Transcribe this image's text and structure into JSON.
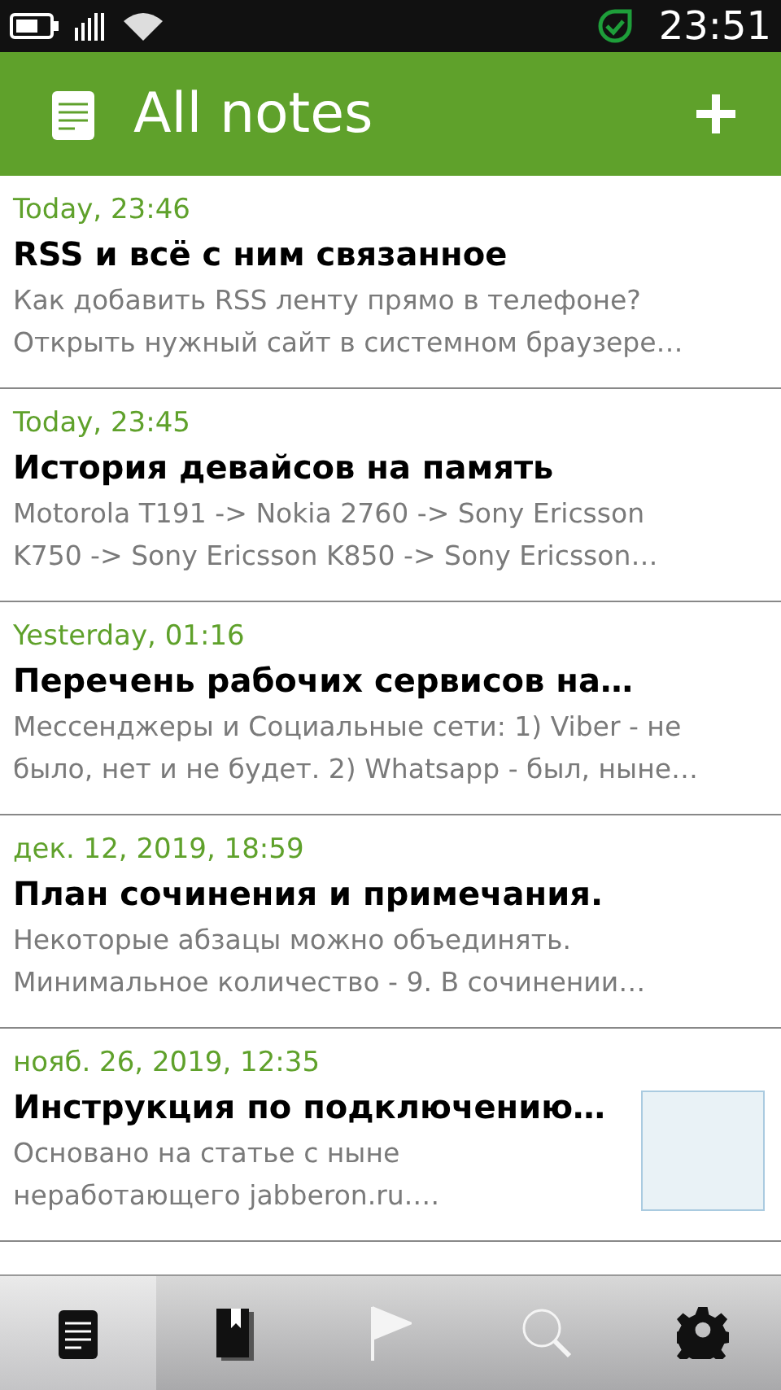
{
  "status_bar": {
    "time": "23:51"
  },
  "header": {
    "title": "All notes"
  },
  "notes": [
    {
      "date": "Today, 23:46",
      "title": "RSS и всё с ним связанное",
      "preview": "Как добавить RSS ленту прямо в телефоне?\nОткрыть нужный сайт в системном браузере…",
      "thumbnail": false
    },
    {
      "date": "Today, 23:45",
      "title": "История девайсов на память",
      "preview": "Motorola T191 -> Nokia 2760 -> Sony Ericsson\nK750 -> Sony Ericsson K850 -> Sony Ericsson…",
      "thumbnail": false
    },
    {
      "date": "Yesterday, 01:16",
      "title": "Перечень рабочих сервисов на…",
      "preview": "Мессенджеры и Социальные сети: 1) Viber - не\nбыло, нет и не будет. 2) Whatsapp - был, ныне…",
      "thumbnail": false
    },
    {
      "date": "дек. 12, 2019, 18:59",
      "title": "План сочинения и примечания.",
      "preview": "Некоторые абзацы можно объединять.\nМинимальное количество - 9. В сочинении…",
      "thumbnail": false
    },
    {
      "date": "нояб. 26, 2019, 12:35",
      "title": "Инструкция по подключению…",
      "preview": "Основано на статье с ныне\nнеработающего jabberon.ru.…",
      "thumbnail": true
    }
  ],
  "tab_bar": [
    {
      "kind": "notes",
      "selected": true,
      "disabled": false
    },
    {
      "kind": "notebook",
      "selected": false,
      "disabled": false
    },
    {
      "kind": "flag",
      "selected": false,
      "disabled": true
    },
    {
      "kind": "search",
      "selected": false,
      "disabled": true
    },
    {
      "kind": "settings",
      "selected": false,
      "disabled": false
    }
  ]
}
